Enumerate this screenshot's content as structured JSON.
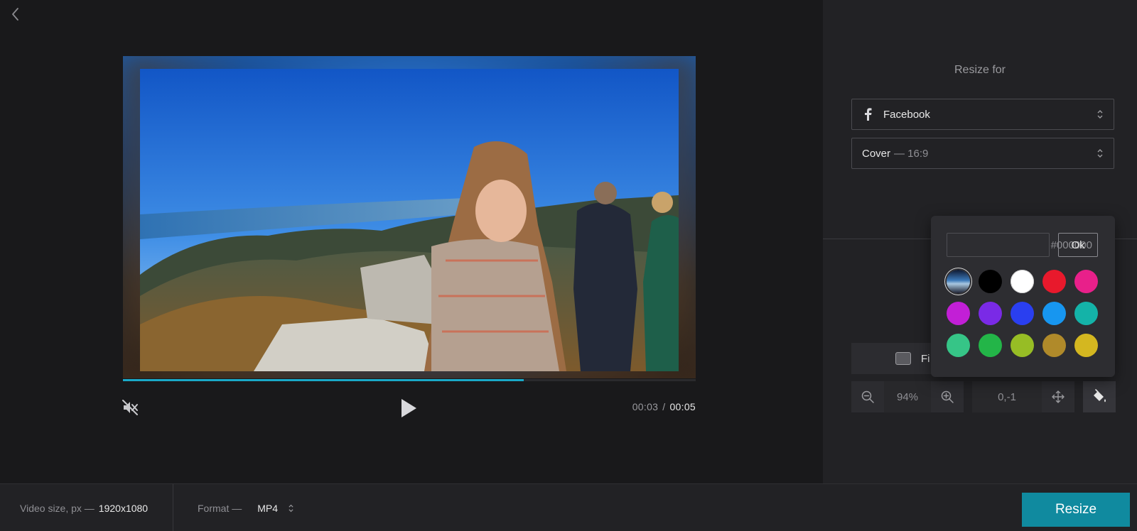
{
  "editor": {
    "back_icon": "chevron-left-icon",
    "video": {
      "description_icon": "video-frame",
      "progress": 0.7,
      "time_current": "00:03",
      "time_separator": "/",
      "time_total": "00:05"
    }
  },
  "panel": {
    "heading": "Resize for",
    "platform": {
      "label": "Facebook",
      "icon": "facebook-icon"
    },
    "preset": {
      "label": "Cover",
      "sub": "— 16:9"
    },
    "fit_label": "Fi",
    "zoom_value": "94%",
    "position_value": "0,-1"
  },
  "color_picker": {
    "hex_value": "#000000",
    "ok_label": "Ok",
    "current_color": "#000000",
    "swatches": [
      "gradient",
      "#000000",
      "#ffffff",
      "#e8192c",
      "#e8208a",
      "#c21fd6",
      "#7a2ae6",
      "#2a3ff0",
      "#1796f0",
      "#14b3a8",
      "#36c587",
      "#23b548",
      "#97bd25",
      "#b08a2a",
      "#d4b720"
    ]
  },
  "bottom": {
    "video_size_label": "Video size, px —",
    "video_size_value": "1920x1080",
    "format_label": "Format —",
    "format_value": "MP4",
    "resize_label": "Resize"
  },
  "colors": {
    "accent": "#108a9f",
    "progress": "#1aa9c8",
    "background": "#19191b",
    "panel": "#222225"
  }
}
